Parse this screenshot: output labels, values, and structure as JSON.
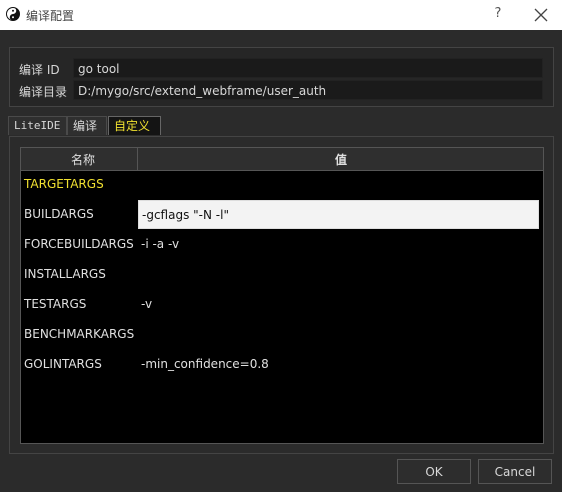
{
  "window": {
    "title": "编译配置",
    "help_label": "?",
    "icon": "yin-yang-icon"
  },
  "info": {
    "build_id_label": "编译 ID",
    "build_id_value": "go tool",
    "build_dir_label": "编译目录",
    "build_dir_value": "D:/mygo/src/extend_webframe/user_auth"
  },
  "tabs": [
    {
      "label": "LiteIDE",
      "active": false
    },
    {
      "label": "编译",
      "active": false
    },
    {
      "label": "自定义",
      "active": true
    }
  ],
  "table": {
    "headers": {
      "name": "名称",
      "value": "值"
    },
    "rows": [
      {
        "key": "TARGETARGS",
        "value": ""
      },
      {
        "key": "BUILDARGS",
        "value": "-gcflags \"-N -l\""
      },
      {
        "key": "FORCEBUILDARGS",
        "value": "-i -a -v"
      },
      {
        "key": "INSTALLARGS",
        "value": ""
      },
      {
        "key": "TESTARGS",
        "value": "-v"
      },
      {
        "key": "BENCHMARKARGS",
        "value": ""
      },
      {
        "key": "GOLINTARGS",
        "value": "-min_confidence=0.8"
      }
    ]
  },
  "buttons": {
    "ok": "OK",
    "cancel": "Cancel"
  },
  "colors": {
    "accent": "#f0e030",
    "background": "#2b2b2b",
    "table_bg": "#000000"
  }
}
